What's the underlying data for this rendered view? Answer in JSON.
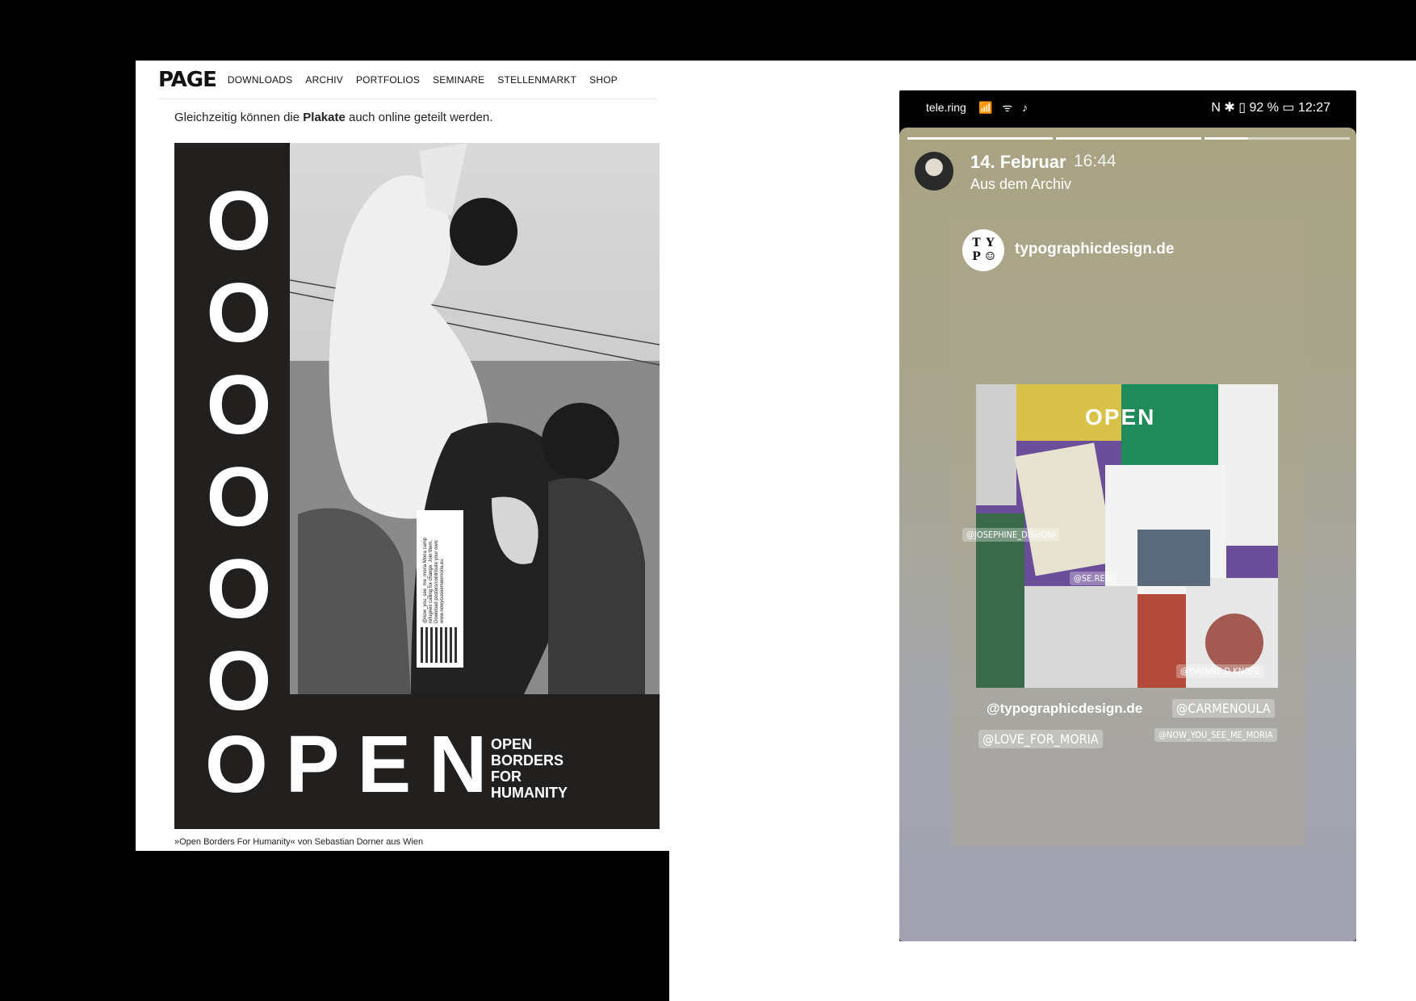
{
  "web": {
    "logo": "PAGE",
    "nav": [
      "DOWNLOADS",
      "ARCHIV",
      "PORTFOLIOS",
      "SEMINARE",
      "STELLENMARKT",
      "SHOP"
    ],
    "intro_before": "Gleichzeitig können die ",
    "intro_bold": "Plakate",
    "intro_after": " auch online geteilt werden.",
    "poster": {
      "o_letters": [
        "O",
        "O",
        "O",
        "O",
        "O",
        "O"
      ],
      "open_word": "OPEN",
      "subtitle_lines": [
        "OPEN",
        "BORDERS",
        "FOR",
        "HUMANITY"
      ],
      "qr_card_text": "@now_you_see_me_moria Moria camp refugees calling for change. Join them. Download posters/contribute your own: www.nowyouseemenmoria.eu"
    },
    "caption": "»Open Borders For Humanity« von Sebastian Dorner aus Wien"
  },
  "phone": {
    "status": {
      "carrier": "tele.ring",
      "icons": "📶 ᯤ ♪",
      "right": "N ✱ ▯ 92 % ▭ 12:27"
    },
    "story": {
      "date": "14. Februar",
      "time": "16:44",
      "subtitle": "Aus dem Archiv",
      "post_user": "typographicdesign.de",
      "post_avatar_letters": [
        "T",
        "Y",
        "P",
        "☺"
      ],
      "collage_open": "OPEN",
      "tags": {
        "josephine": "@JOSEPHINE_DISHONI",
        "se_reis": "@SE.REIS",
        "typographicdesign": "@typographicdesign.de",
        "carmenoula": "@CARMENOULA",
        "love_for_moria": "@LOVE_FOR_MORIA",
        "now_you_see_me": "@NOW_YOU_SEE_ME_MORIA",
        "knope": "@YVONNE.D.KNOPE"
      }
    }
  }
}
